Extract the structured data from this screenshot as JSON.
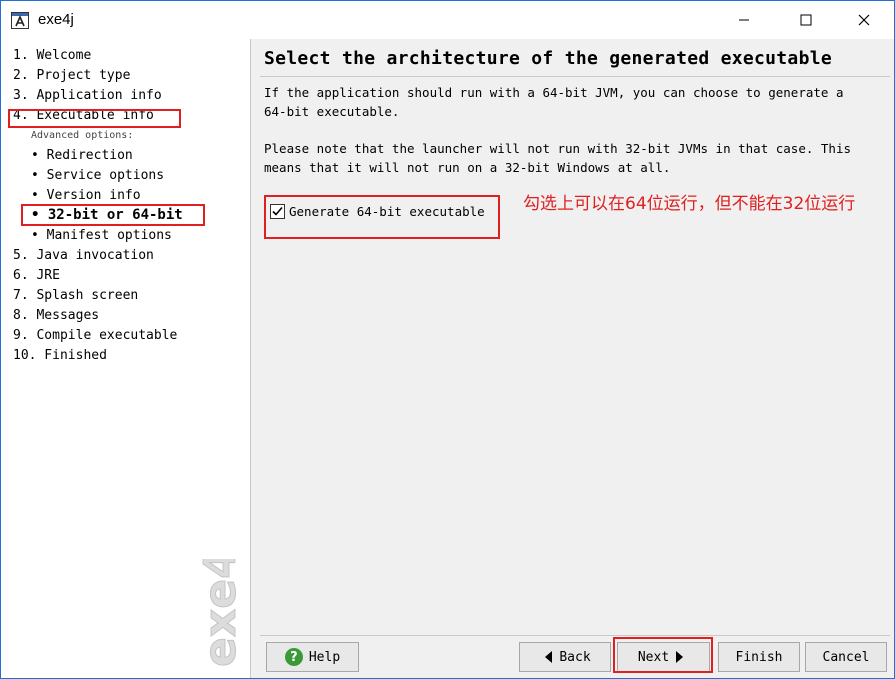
{
  "window": {
    "title": "exe4j",
    "app_icon_letter": "A"
  },
  "sidebar": {
    "items": [
      {
        "label": "1. Welcome"
      },
      {
        "label": "2. Project type"
      },
      {
        "label": "3. Application info"
      },
      {
        "label": "4. Executable info"
      }
    ],
    "advanced_label": "Advanced options:",
    "sub_items": [
      {
        "label": "• Redirection"
      },
      {
        "label": "• Service options"
      },
      {
        "label": "• Version info"
      },
      {
        "label": "• 32-bit or 64-bit"
      },
      {
        "label": "• Manifest options"
      }
    ],
    "items_after": [
      {
        "label": "5. Java invocation"
      },
      {
        "label": "6. JRE"
      },
      {
        "label": "7. Splash screen"
      },
      {
        "label": "8. Messages"
      },
      {
        "label": "9. Compile executable"
      },
      {
        "label": "10. Finished"
      }
    ],
    "watermark": "exe4j"
  },
  "main": {
    "heading": "Select the architecture of the generated executable",
    "paragraph1": "If the application should run with a 64-bit JVM, you can choose to generate a\n64-bit executable.",
    "paragraph2": "Please note that the launcher will not run with 32-bit JVMs in that case. This\nmeans that it will not run on a 32-bit Windows at all.",
    "checkbox": {
      "label": "Generate 64-bit executable",
      "checked": true
    },
    "annotation": "勾选上可以在64位运行，但不能在32位运行"
  },
  "buttons": {
    "help": "Help",
    "back": "Back",
    "next": "Next",
    "finish": "Finish",
    "cancel": "Cancel"
  },
  "colors": {
    "highlight_box": "#e02020",
    "annotation_text": "#e02020",
    "window_border": "#1f6fd6"
  }
}
